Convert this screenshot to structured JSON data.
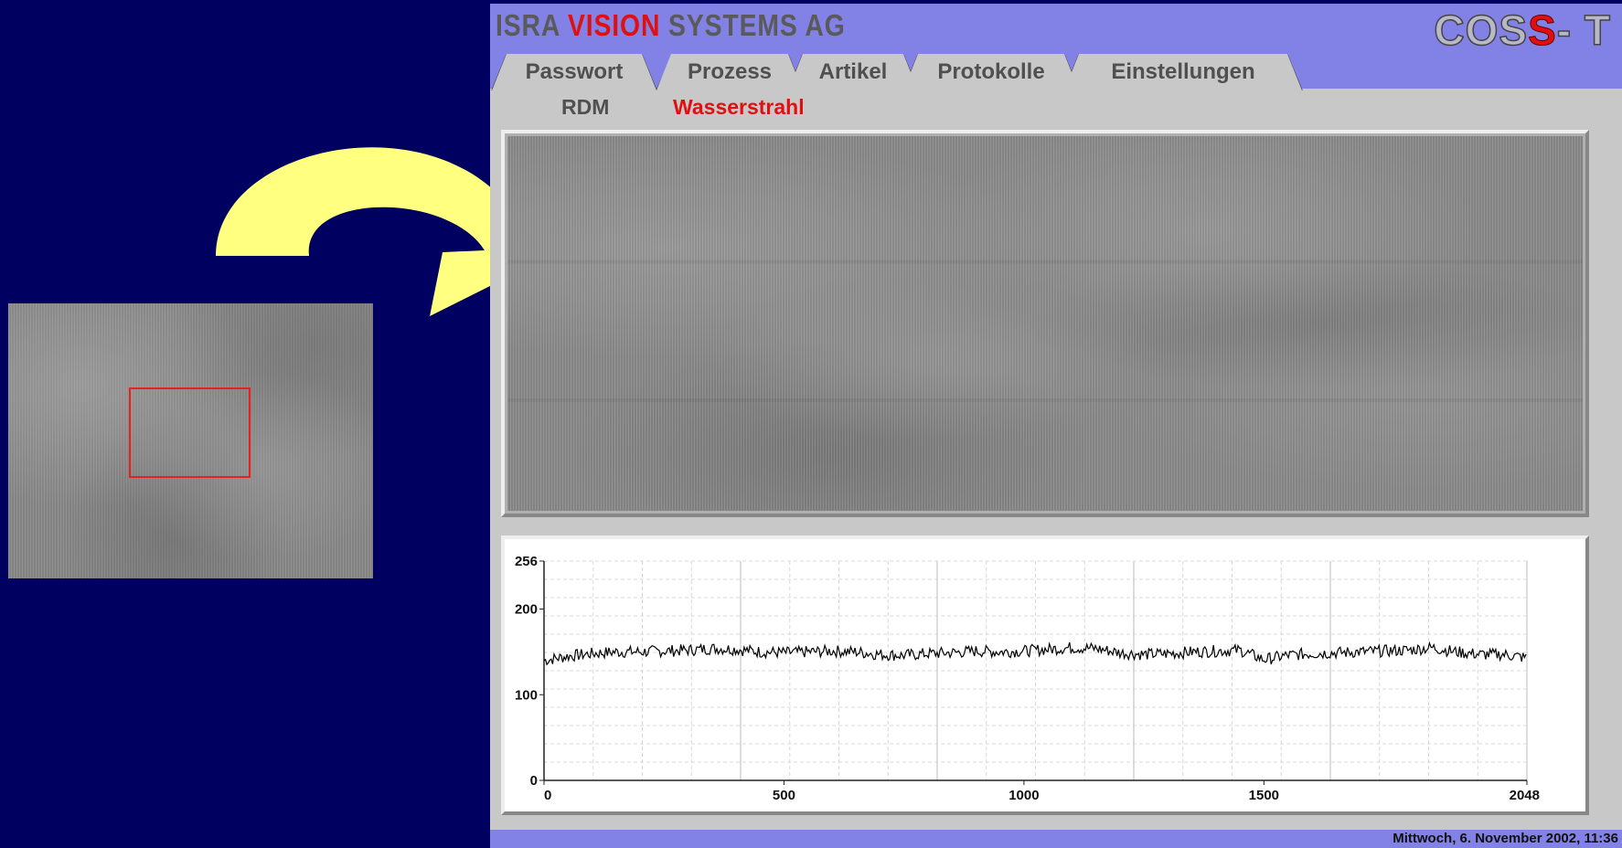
{
  "header": {
    "brand_prefix": "ISRA ",
    "brand_accent": "VISION",
    "brand_suffix": " SYSTEMS AG",
    "product_prefix": "COS",
    "product_accent": "S",
    "product_suffix": "- T"
  },
  "tabs": [
    {
      "label": "Passwort"
    },
    {
      "label": "Prozess"
    },
    {
      "label": "Artikel"
    },
    {
      "label": "Protokolle"
    },
    {
      "label": "Einstellungen"
    }
  ],
  "active_tab": "Prozess",
  "subtabs": [
    {
      "label": "RDM"
    },
    {
      "label": "Wasserstrahl"
    }
  ],
  "active_subtab": "Wasserstrahl",
  "status": {
    "datetime": "Mittwoch, 6. November 2002, 11:36"
  },
  "colors": {
    "background": "#000060",
    "titlebar": "#8282e6",
    "accent": "#e01010",
    "arrow": "#ffff80",
    "roi": "#e82020"
  },
  "chart_data": {
    "type": "line",
    "title": "",
    "xlabel": "",
    "ylabel": "",
    "xlim": [
      0,
      2048
    ],
    "ylim": [
      0,
      256
    ],
    "x_ticks": [
      0,
      500,
      1000,
      1500,
      2048
    ],
    "y_ticks": [
      0,
      100,
      200,
      256
    ],
    "grid": true,
    "series": [
      {
        "values_description_free": true,
        "x": [
          0,
          50,
          100,
          150,
          200,
          250,
          300,
          350,
          400,
          450,
          500,
          550,
          600,
          650,
          700,
          750,
          800,
          850,
          900,
          950,
          1000,
          1050,
          1100,
          1150,
          1200,
          1250,
          1300,
          1350,
          1400,
          1450,
          1500,
          1550,
          1600,
          1650,
          1700,
          1750,
          1800,
          1850,
          1900,
          1950,
          2000,
          2048
        ],
        "y": [
          140,
          145,
          148,
          150,
          150,
          151,
          152,
          154,
          153,
          150,
          149,
          150,
          151,
          150,
          147,
          146,
          148,
          149,
          151,
          150,
          151,
          153,
          155,
          154,
          149,
          147,
          148,
          150,
          151,
          152,
          141,
          146,
          148,
          149,
          150,
          151,
          152,
          155,
          150,
          147,
          147,
          143
        ]
      }
    ]
  }
}
